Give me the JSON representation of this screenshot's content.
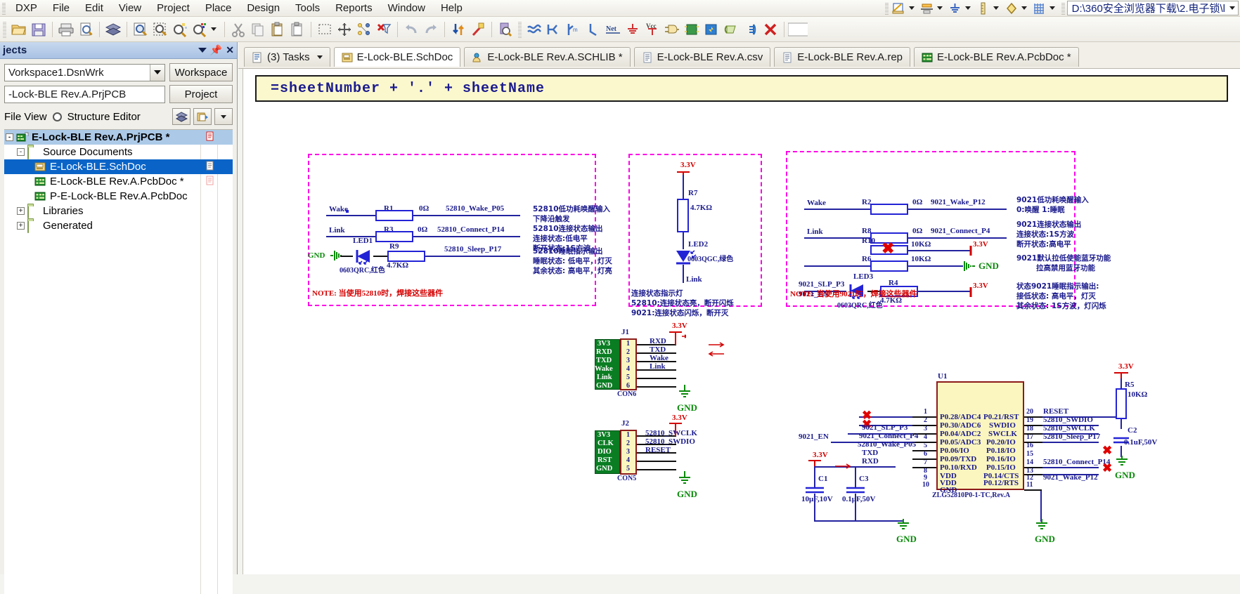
{
  "app": {
    "menus": [
      "DXP",
      "File",
      "Edit",
      "View",
      "Project",
      "Place",
      "Design",
      "Tools",
      "Reports",
      "Window",
      "Help"
    ],
    "path_value": "D:\\360安全浏览器下载\\2.电子锁\\l"
  },
  "toolbar": {
    "icons": [
      "open-file-icon",
      "save-icon",
      "print-icon",
      "print-preview-icon",
      "board-icon",
      "zoom-fit-icon",
      "zoom-area-icon",
      "zoom-in-icon",
      "zoom-selected-icon",
      "cut-icon",
      "copy-icon",
      "paste-icon",
      "paste-special-icon",
      "select-area-icon",
      "move-icon",
      "align-icon",
      "clear-filter-icon",
      "undo-icon",
      "redo-icon",
      "updown-icon",
      "wand-icon",
      "browse-component-icon",
      "wire-icon",
      "bus-icon",
      "bus-entry-icon",
      "line-icon",
      "net-label-icon",
      "gnd-power-icon",
      "vcc-power-icon",
      "part-icon",
      "sheet-symbol-icon",
      "sheet-entry-icon",
      "port-icon",
      "no-erc-icon",
      "delete-icon"
    ],
    "right_icons": [
      "sch-edit-icon",
      "alignment-icon",
      "gnd-icon",
      "ruler-icon",
      "hex-icon",
      "grid-icon"
    ]
  },
  "panel": {
    "title": "jects",
    "workspace_value": "Vorkspace1.DsnWrk",
    "workspace_button": "Workspace",
    "project_value": "-Lock-BLE Rev.A.PrjPCB",
    "project_button": "Project",
    "file_view_label": "File View",
    "structure_editor_label": "Structure Editor",
    "tree": [
      {
        "label": "E-Lock-BLE Rev.A.PrjPCB *",
        "icon": "project-icon",
        "indent": 0,
        "state": "selected-project",
        "expander": "-",
        "mark": "red-doc"
      },
      {
        "label": "Source Documents",
        "icon": "folder-icon",
        "indent": 1,
        "state": "normal",
        "expander": "-",
        "mark": ""
      },
      {
        "label": "E-Lock-BLE.SchDoc",
        "icon": "schdoc-icon",
        "indent": 2,
        "state": "selected-file",
        "expander": "",
        "mark": "grey-doc"
      },
      {
        "label": "E-Lock-BLE Rev.A.PcbDoc *",
        "icon": "pcbdoc-icon",
        "indent": 2,
        "state": "normal",
        "expander": "",
        "mark": "pink-doc"
      },
      {
        "label": "P-E-Lock-BLE Rev.A.PcbDoc",
        "icon": "pcbdoc-icon",
        "indent": 2,
        "state": "normal",
        "expander": "",
        "mark": ""
      },
      {
        "label": "Libraries",
        "icon": "folder-icon",
        "indent": 1,
        "state": "normal",
        "expander": "+",
        "mark": ""
      },
      {
        "label": "Generated",
        "icon": "folder-icon",
        "indent": 1,
        "state": "normal",
        "expander": "+",
        "mark": ""
      }
    ]
  },
  "doctabs": [
    {
      "label": "(3) Tasks",
      "icon": "tasks-icon",
      "active": false,
      "caret": true
    },
    {
      "label": "E-Lock-BLE.SchDoc",
      "icon": "schdoc-icon",
      "active": true,
      "caret": false
    },
    {
      "label": "E-Lock-BLE Rev.A.SCHLIB *",
      "icon": "schlib-icon",
      "active": false,
      "caret": false
    },
    {
      "label": "E-Lock-BLE Rev.A.csv",
      "icon": "text-doc-icon",
      "active": false,
      "caret": false
    },
    {
      "label": "E-Lock-BLE Rev.A.rep",
      "icon": "text-doc-icon",
      "active": false,
      "caret": false
    },
    {
      "label": "E-Lock-BLE Rev.A.PcbDoc *",
      "icon": "pcbdoc-icon",
      "active": false,
      "caret": false
    }
  ],
  "sheet": {
    "title_text": "=sheetNumber + '.'  + sheetName",
    "blocks": {
      "left": {
        "note": "NOTE: 当使用52810时，焊接这些器件",
        "rows": [
          {
            "net_in": "Wake",
            "ref": "R1",
            "value": "0Ω",
            "net_out": "52810_Wake_P05",
            "desc": [
              "52810低功耗唤醒输入",
              "下降沿触发"
            ]
          },
          {
            "net_in": "Link",
            "ref": "R3",
            "value": "0Ω",
            "net_out": "52810_Connect_P14",
            "desc": [
              "52810连接状态输出",
              "连接状态:低电平",
              "断开状态:1S方波"
            ]
          },
          {
            "net_in": "GND",
            "ref": "R9",
            "value": "4.7KΩ",
            "net_out": "52810_Sleep_P17",
            "led": "LED1",
            "led_part": "0603QRC,红色",
            "desc": [
              "52810睡眠指示输出",
              "睡眠状态: 低电平，灯灭",
              "其余状态: 高电平，灯亮"
            ]
          }
        ]
      },
      "middle": {
        "power": "3.3V",
        "ref": "R7",
        "value": "4.7KΩ",
        "led": "LED2",
        "led_part": "0603QGC,绿色",
        "net": "Link",
        "desc": [
          "连接状态指示灯",
          "52810:连接状态亮，断开闪烁",
          "9021:连接状态闪烁，断开灭"
        ]
      },
      "right": {
        "note": "NOTE: 当使用9021时，焊接这些器件",
        "rows": [
          {
            "net_in": "Wake",
            "ref": "R2",
            "value": "0Ω",
            "net_out": "9021_Wake_P12",
            "desc": [
              "9021低功耗唤醒输入",
              "0:唤醒  1:睡眠"
            ]
          },
          {
            "net_in": "Link",
            "ref": "R8",
            "value": "0Ω",
            "net_out": "9021_Connect_P4",
            "desc": [
              "9021连接状态输出",
              "连接状态:1S方波",
              "断开状态:高电平"
            ]
          },
          {
            "net_in": "",
            "ref": "R10",
            "value": "10KΩ",
            "net_out": "3.3V",
            "crossed": true
          },
          {
            "net_in": "9021_EN",
            "ref": "R6",
            "value": "10KΩ",
            "net_out": "GND",
            "desc": [
              "9021默认拉低使能蓝牙功能",
              "拉高禁用蓝牙功能"
            ]
          },
          {
            "net_in": "9021_SLP_P3",
            "ref": "R4",
            "value": "4.7KΩ",
            "net_out": "3.3V",
            "led": "LED3",
            "led_part": "0603QRC,红色",
            "desc": [
              "状态9021睡眠指示输出:",
              "接低状态: 高电平，灯灭",
              "其余状态: 1S方波，灯闪烁"
            ]
          }
        ]
      }
    },
    "connectors": [
      {
        "ref": "J1",
        "part": "CON6",
        "pins": [
          {
            "no": "1",
            "name": "3V3",
            "net": "RXD"
          },
          {
            "no": "2",
            "name": "RXD",
            "net": "TXD"
          },
          {
            "no": "3",
            "name": "TXD",
            "net": "Wake"
          },
          {
            "no": "4",
            "name": "Wake",
            "net": "Link"
          },
          {
            "no": "5",
            "name": "Link",
            "net": ""
          },
          {
            "no": "6",
            "name": "GND",
            "net": ""
          }
        ],
        "power": "3.3V",
        "gnd": "GND"
      },
      {
        "ref": "J2",
        "part": "CON5",
        "pins": [
          {
            "no": "1",
            "name": "3V3",
            "net": "52810_SWCLK"
          },
          {
            "no": "2",
            "name": "CLK",
            "net": "52810_SWDIO"
          },
          {
            "no": "3",
            "name": "DIO",
            "net": "RESET"
          },
          {
            "no": "4",
            "name": "RST",
            "net": ""
          },
          {
            "no": "5",
            "name": "GND",
            "net": ""
          }
        ],
        "power": "3.3V",
        "gnd": "GND"
      }
    ],
    "u1": {
      "ref": "U1",
      "part": "ZLG52810P0-1-TC,Rev.A",
      "left_pins": [
        {
          "no": "1",
          "label": "P0.28/ADC4",
          "net": ""
        },
        {
          "no": "2",
          "label": "P0.30/ADC6",
          "net": ""
        },
        {
          "no": "3",
          "label": "P0.04/ADC2",
          "net": "9021_SLP_P3"
        },
        {
          "no": "4",
          "label": "P0.05/ADC3",
          "net": "9021_Connect_P4"
        },
        {
          "no": "5",
          "label": "P0.06/IO",
          "net": "52810_Wake_P05"
        },
        {
          "no": "6",
          "label": "P0.09/TXD",
          "net": "TXD"
        },
        {
          "no": "7",
          "label": "P0.10/RXD",
          "net": "RXD"
        },
        {
          "no": "8",
          "label": "VDD",
          "net": ""
        },
        {
          "no": "9",
          "label": "VDD",
          "net": ""
        },
        {
          "no": "10",
          "label": "GND",
          "net": ""
        }
      ],
      "right_pins": [
        {
          "no": "20",
          "label": "P0.21/RST",
          "net": "RESET"
        },
        {
          "no": "19",
          "label": "SWDIO",
          "net": "52810_SWDIO"
        },
        {
          "no": "18",
          "label": "SWCLK",
          "net": "52810_SWCLK"
        },
        {
          "no": "17",
          "label": "P0.20/IO",
          "net": "52810_Sleep_P17"
        },
        {
          "no": "16",
          "label": "P0.18/IO",
          "net": ""
        },
        {
          "no": "15",
          "label": "P0.16/IO",
          "net": ""
        },
        {
          "no": "14",
          "label": "P0.15/IO",
          "net": "52810_Connect_P14"
        },
        {
          "no": "13",
          "label": "P0.14/CTS",
          "net": ""
        },
        {
          "no": "12",
          "label": "P0.12/RTS",
          "net": "9021_Wake_P12"
        },
        {
          "no": "11",
          "label": "",
          "net": ""
        }
      ],
      "caps": [
        {
          "ref": "C1",
          "value": "10μF,10V"
        },
        {
          "ref": "C3",
          "value": "0.1μF,50V"
        },
        {
          "ref": "C2",
          "value": "0.1uF,50V"
        }
      ],
      "pullup": {
        "ref": "R5",
        "value": "10KΩ",
        "power": "3.3V"
      },
      "power": "3.3V",
      "gnds": [
        "GND",
        "GND",
        "GND"
      ]
    }
  },
  "colors": {
    "net": "#1a1a8c",
    "wire": "#2323a0",
    "dashed_box": "#ff00e8",
    "chip_fill": "#fbf6bf",
    "chip_border": "#8d1a1a",
    "connector_green": "#0a7d23",
    "power_red": "#d40000",
    "gnd_green": "#0a8a0a",
    "sheet_title_bg": "#fbf8cd",
    "selection_blue": "#0a64c8"
  }
}
